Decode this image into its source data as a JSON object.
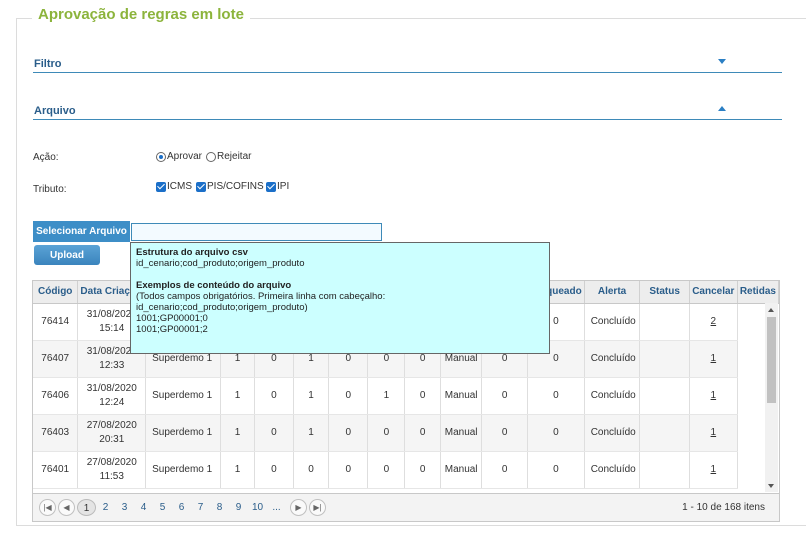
{
  "page": {
    "title": "Aprovação de regras em lote"
  },
  "sections": {
    "filtro": "Filtro",
    "arquivo": "Arquivo"
  },
  "form": {
    "acao_label": "Ação:",
    "acao_options": [
      "Aprovar",
      "Rejeitar"
    ],
    "tributo_label": "Tributo:",
    "tributo_options": [
      "ICMS",
      "PIS/COFINS",
      "IPI"
    ],
    "select_file_label": "Selecionar Arquivo",
    "upload_label": "Upload"
  },
  "tooltip": {
    "title": "Estrutura do arquivo csv",
    "structure": "id_cenario;cod_produto;origem_produto",
    "examples_title": "Exemplos de conteúdo do arquivo",
    "lines": [
      "(Todos campos obrigatórios. Primeira linha com cabeçalho:",
      "id_cenario;cod_produto;origem_produto)",
      "1001;GP00001;0",
      "1001;GP00001;2"
    ]
  },
  "table": {
    "headers": [
      "Código",
      "Data Criação",
      "",
      "",
      "",
      "",
      "",
      "",
      "",
      "",
      "Bloqueado",
      "Alerta",
      "Status",
      "Cancelar",
      "Retidas"
    ],
    "rows": [
      [
        "76414",
        "31/08/2020",
        "15:14",
        "",
        "",
        "",
        "",
        "",
        "",
        "",
        "",
        "",
        "0",
        "Concluído",
        "",
        "2"
      ],
      [
        "76407",
        "31/08/2020",
        "12:33",
        "Superdemo 1",
        "1",
        "0",
        "1",
        "0",
        "0",
        "0",
        "Manual",
        "0",
        "0",
        "Concluído",
        "",
        "1"
      ],
      [
        "76406",
        "31/08/2020",
        "12:24",
        "Superdemo 1",
        "1",
        "0",
        "1",
        "0",
        "1",
        "0",
        "Manual",
        "0",
        "0",
        "Concluído",
        "",
        "1"
      ],
      [
        "76403",
        "27/08/2020",
        "20:31",
        "Superdemo 1",
        "1",
        "0",
        "1",
        "0",
        "0",
        "0",
        "Manual",
        "0",
        "0",
        "Concluído",
        "",
        "1"
      ],
      [
        "76401",
        "27/08/2020",
        "11:53",
        "Superdemo 1",
        "1",
        "0",
        "0",
        "0",
        "0",
        "0",
        "Manual",
        "0",
        "0",
        "Concluído",
        "",
        "1"
      ]
    ]
  },
  "pager": {
    "pages": [
      "1",
      "2",
      "3",
      "4",
      "5",
      "6",
      "7",
      "8",
      "9",
      "10",
      "..."
    ],
    "info": "1 - 10 de 168 itens"
  }
}
